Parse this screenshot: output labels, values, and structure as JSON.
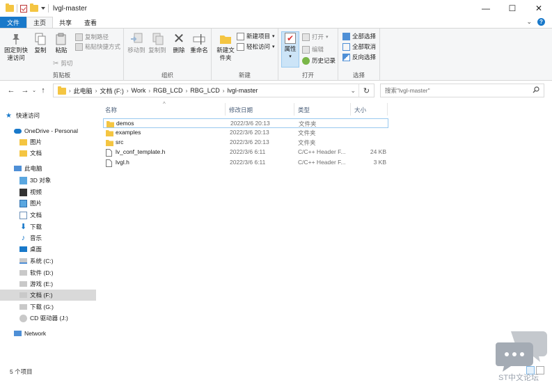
{
  "window": {
    "title": "lvgl-master",
    "controls": {
      "minimize": "—",
      "maximize": "☐",
      "close": "✕"
    }
  },
  "ribbon_tabs": [
    "文件",
    "主页",
    "共享",
    "查看"
  ],
  "ribbon": {
    "clipboard": {
      "label": "剪贴板",
      "pin": "固定到快速访问",
      "copy": "复制",
      "paste": "粘贴",
      "copy_path": "复制路径",
      "paste_shortcut": "粘贴快捷方式",
      "cut": "剪切"
    },
    "organize": {
      "label": "组织",
      "move_to": "移动到",
      "copy_to": "复制到",
      "delete": "删除",
      "rename": "重命名"
    },
    "new": {
      "label": "新建",
      "new_folder": "新建文件夹",
      "new_item": "新建项目",
      "easy_access": "轻松访问"
    },
    "open": {
      "label": "打开",
      "properties": "属性",
      "open": "打开",
      "edit": "编辑",
      "history": "历史记录"
    },
    "select": {
      "label": "选择",
      "select_all": "全部选择",
      "select_none": "全部取消",
      "invert": "反向选择"
    }
  },
  "address": {
    "crumbs": [
      "此电脑",
      "文档 (F:)",
      "Work",
      "RGB_LCD",
      "RBG_LCD",
      "lvgl-master"
    ],
    "search_placeholder": "搜索\"lvgl-master\""
  },
  "sidebar": {
    "quick_access": "快速访问",
    "onedrive": "OneDrive - Personal",
    "od_pictures": "图片",
    "od_docs": "文档",
    "this_pc": "此电脑",
    "objects3d": "3D 对象",
    "videos": "视频",
    "pictures": "图片",
    "documents": "文档",
    "downloads": "下载",
    "music": "音乐",
    "desktop": "桌面",
    "drive_c": "系统 (C:)",
    "drive_d": "软件 (D:)",
    "drive_e": "游戏 (E:)",
    "drive_f": "文档 (F:)",
    "drive_g": "下载 (G:)",
    "drive_j": "CD 驱动器 (J:)",
    "network": "Network"
  },
  "columns": {
    "name": "名称",
    "modified": "修改日期",
    "type": "类型",
    "size": "大小"
  },
  "files": [
    {
      "name": "demos",
      "modified": "2022/3/6 20:13",
      "type": "文件夹",
      "size": "",
      "kind": "folder"
    },
    {
      "name": "examples",
      "modified": "2022/3/6 20:13",
      "type": "文件夹",
      "size": "",
      "kind": "folder"
    },
    {
      "name": "src",
      "modified": "2022/3/6 20:13",
      "type": "文件夹",
      "size": "",
      "kind": "folder"
    },
    {
      "name": "lv_conf_template.h",
      "modified": "2022/3/6 6:11",
      "type": "C/C++ Header F...",
      "size": "24 KB",
      "kind": "file"
    },
    {
      "name": "lvgl.h",
      "modified": "2022/3/6 6:11",
      "type": "C/C++ Header F...",
      "size": "3 KB",
      "kind": "file"
    }
  ],
  "status": {
    "count": "5 个项目"
  },
  "watermark": {
    "text": "ST中文论坛"
  },
  "colors": {
    "accent": "#1979ca",
    "folder": "#f4c542",
    "selection": "#cce4f7"
  }
}
